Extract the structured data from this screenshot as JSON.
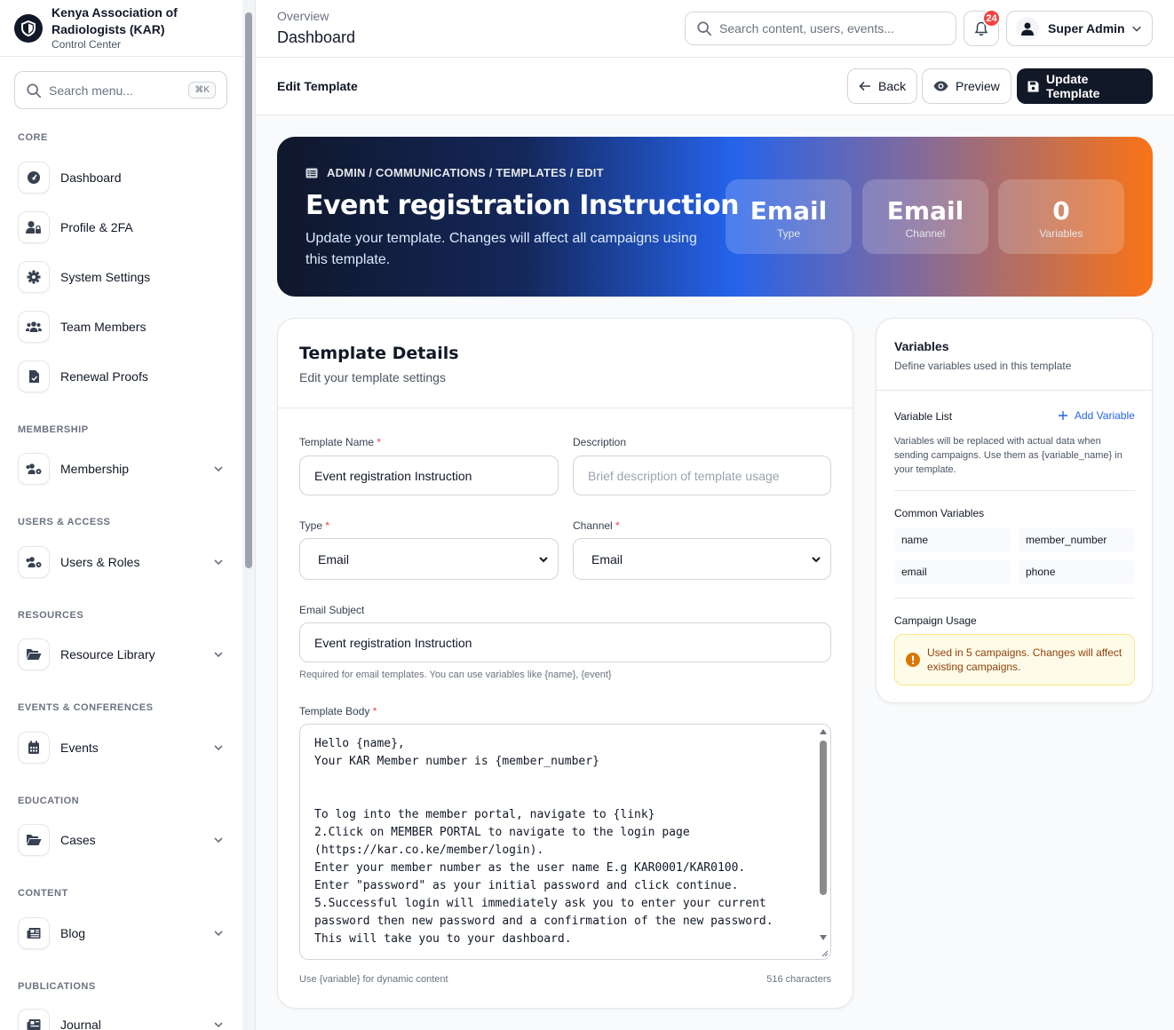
{
  "brand": {
    "name": "Kenya Association of Radiologists (KAR)",
    "subtitle": "Control Center"
  },
  "sidebar": {
    "search_placeholder": "Search menu...",
    "shortcut": "⌘K",
    "sections": {
      "core": "CORE",
      "membership": "MEMBERSHIP",
      "users": "USERS & ACCESS",
      "resources": "RESOURCES",
      "events": "EVENTS & CONFERENCES",
      "education": "EDUCATION",
      "content": "CONTENT",
      "publications": "PUBLICATIONS"
    },
    "items": {
      "dashboard": "Dashboard",
      "profile": "Profile & 2FA",
      "settings": "System Settings",
      "team": "Team Members",
      "renewal": "Renewal Proofs",
      "membership": "Membership",
      "users": "Users & Roles",
      "resource_library": "Resource Library",
      "events": "Events",
      "cases": "Cases",
      "blog": "Blog",
      "journal": "Journal"
    }
  },
  "topbar": {
    "overview": "Overview",
    "title": "Dashboard",
    "search_placeholder": "Search content, users, events...",
    "notifications": "24",
    "user": "Super Admin"
  },
  "subbar": {
    "title": "Edit Template",
    "back": "Back",
    "preview": "Preview",
    "update": "Update Template"
  },
  "hero": {
    "breadcrumb": "ADMIN / COMMUNICATIONS / TEMPLATES / EDIT",
    "title": "Event registration Instruction",
    "description": "Update your template. Changes will affect all campaigns using this template.",
    "stats": [
      {
        "value": "Email",
        "label": "Type"
      },
      {
        "value": "Email",
        "label": "Channel"
      },
      {
        "value": "0",
        "label": "Variables"
      }
    ]
  },
  "form": {
    "title": "Template Details",
    "subtitle": "Edit your template settings",
    "name_label": "Template Name",
    "name_value": "Event registration Instruction",
    "desc_label": "Description",
    "desc_placeholder": "Brief description of template usage",
    "type_label": "Type",
    "type_value": "Email",
    "channel_label": "Channel",
    "channel_value": "Email",
    "subject_label": "Email Subject",
    "subject_value": "Event registration Instruction",
    "subject_help": "Required for email templates. You can use variables like {name}, {event}",
    "body_label": "Template Body",
    "body_value": "Hello {name},\nYour KAR Member number is {member_number}\n\n\nTo log into the member portal, navigate to {link}\n2.Click on MEMBER PORTAL to navigate to the login page\n(https://kar.co.ke/member/login).\nEnter your member number as the user name E.g KAR0001/KAR0100.\nEnter \"password\" as your initial password and click continue.\n5.Successful login will immediately ask you to enter your current\npassword then new password and a confirmation of the new password.\nThis will take you to your dashboard.",
    "body_help": "Use {variable} for dynamic content",
    "char_count": "516 characters",
    "required_mark": "*"
  },
  "variables": {
    "title": "Variables",
    "subtitle": "Define variables used in this template",
    "list_label": "Variable List",
    "add_label": "Add Variable",
    "list_help": "Variables will be replaced with actual data when sending campaigns. Use them as {variable_name} in your template.",
    "common_label": "Common Variables",
    "common": [
      "name",
      "member_number",
      "email",
      "phone"
    ],
    "usage_label": "Campaign Usage",
    "usage_notice": "Used in 5 campaigns. Changes will affect existing campaigns."
  },
  "colors": {
    "primary": "#111827",
    "accent": "#2563eb",
    "warning": "#d97706",
    "danger": "#ef4444"
  }
}
